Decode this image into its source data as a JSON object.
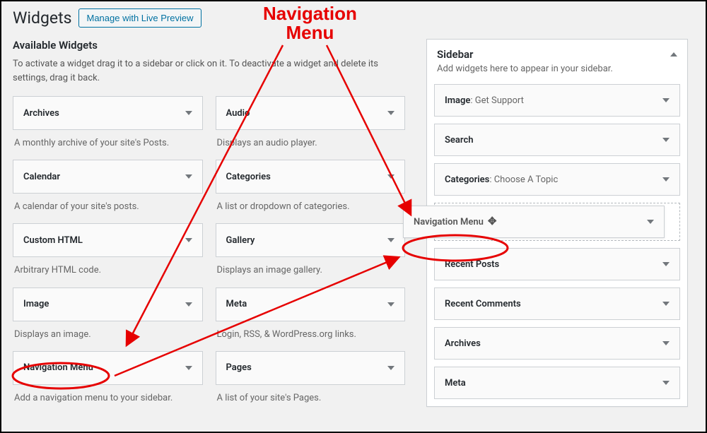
{
  "annotation": {
    "label_line1": "Navigation",
    "label_line2": "Menu"
  },
  "page": {
    "title": "Widgets",
    "preview_button": "Manage with Live Preview"
  },
  "available": {
    "heading": "Available Widgets",
    "description": "To activate a widget drag it to a sidebar or click on it. To deactivate a widget and delete its settings, drag it back.",
    "widgets": [
      {
        "name": "Archives",
        "desc": "A monthly archive of your site's Posts."
      },
      {
        "name": "Audio",
        "desc": "Displays an audio player."
      },
      {
        "name": "Calendar",
        "desc": "A calendar of your site's posts."
      },
      {
        "name": "Categories",
        "desc": "A list or dropdown of categories."
      },
      {
        "name": "Custom HTML",
        "desc": "Arbitrary HTML code."
      },
      {
        "name": "Gallery",
        "desc": "Displays an image gallery."
      },
      {
        "name": "Image",
        "desc": "Displays an image."
      },
      {
        "name": "Meta",
        "desc": "Login, RSS, & WordPress.org links."
      },
      {
        "name": "Navigation Menu",
        "desc": "Add a navigation menu to your sidebar."
      },
      {
        "name": "Pages",
        "desc": "A list of your site's Pages."
      }
    ]
  },
  "sidebar": {
    "title": "Sidebar",
    "description": "Add widgets here to appear in your sidebar.",
    "items": [
      {
        "name": "Image",
        "instance": "Get Support"
      },
      {
        "name": "Search",
        "instance": ""
      },
      {
        "name": "Categories",
        "instance": "Choose A Topic"
      },
      {
        "name": "Recent Posts",
        "instance": ""
      },
      {
        "name": "Recent Comments",
        "instance": ""
      },
      {
        "name": "Archives",
        "instance": ""
      },
      {
        "name": "Meta",
        "instance": ""
      }
    ],
    "dragging": {
      "name": "Navigation Menu"
    }
  }
}
